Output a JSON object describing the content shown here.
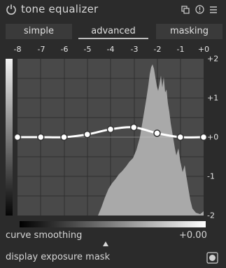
{
  "module": {
    "title": "tone equalizer",
    "icons": [
      "power-icon",
      "presets-icon",
      "reset-icon",
      "menu-icon"
    ]
  },
  "tabs": [
    {
      "label": "simple"
    },
    {
      "label": "advanced"
    },
    {
      "label": "masking"
    }
  ],
  "active_tab": "advanced",
  "graph": {
    "x_ticks": [
      "-8",
      "-7",
      "-6",
      "-5",
      "-4",
      "-3",
      "-2",
      "-1",
      "+0"
    ],
    "y_ticks": [
      "+2",
      "+1",
      "+0",
      "-1",
      "-2"
    ],
    "node_values": [
      0.0,
      0.0,
      0.0,
      0.07,
      0.2,
      0.25,
      0.1,
      0.0,
      0.0
    ]
  },
  "controls": {
    "curve_smoothing_label": "curve smoothing",
    "curve_smoothing_value": "+0.00",
    "display_mask_label": "display exposure mask"
  }
}
